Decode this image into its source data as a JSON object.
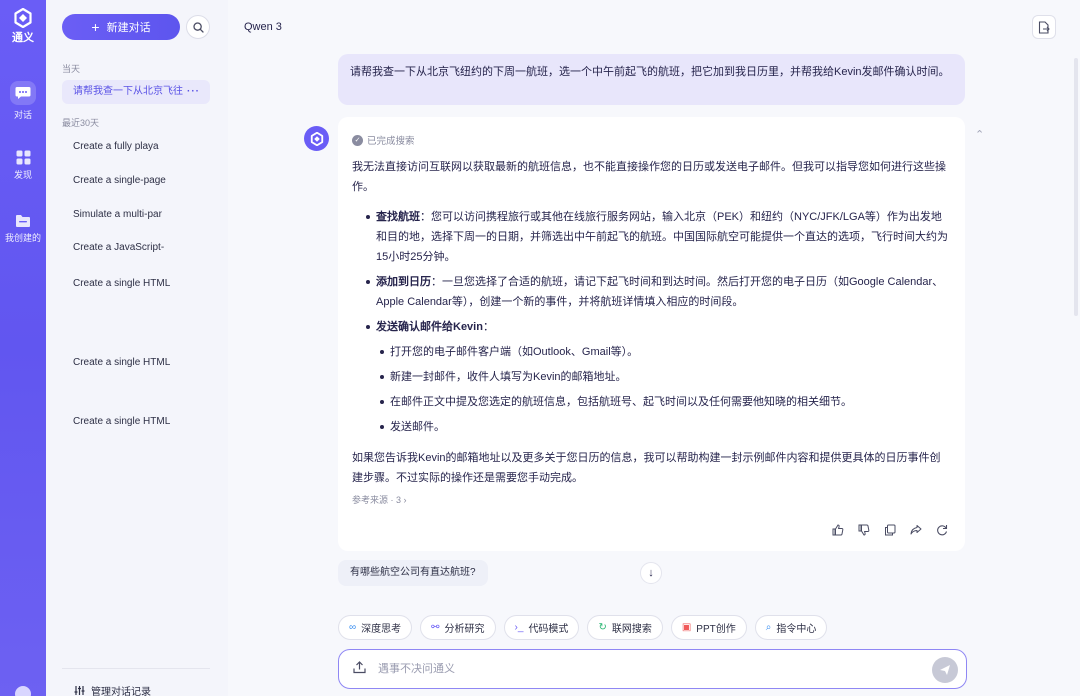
{
  "app": {
    "logo_text": "通义",
    "brand_color": "#6a5df6"
  },
  "rail": {
    "items": [
      {
        "label": "对话",
        "icon": "chat-bubble-icon"
      },
      {
        "label": "发现",
        "icon": "grid-icon"
      },
      {
        "label": "我创建的",
        "icon": "folder-icon"
      }
    ]
  },
  "sidebar": {
    "new_chat_label": "新建对话",
    "today_label": "当天",
    "recent_label": "最近30天",
    "items": [
      {
        "label": "请帮我查一下从北京飞往",
        "more": "···"
      },
      {
        "label": "Create a fully playa"
      },
      {
        "label": "Create a single-page"
      },
      {
        "label": "Simulate a multi-par"
      },
      {
        "label": "Create a JavaScript-"
      },
      {
        "label": "Create a single HTML"
      },
      {
        "label": "Create a single HTML"
      },
      {
        "label": "Create a single HTML"
      }
    ],
    "manage_label": "管理对话记录"
  },
  "main": {
    "model_name": "Qwen 3",
    "user_message": "请帮我查一下从北京飞纽约的下周一航班，选一个中午前起飞的航班，把它加到我日历里，并帮我给Kevin发邮件确认时间。",
    "status": "已完成搜索",
    "intro": "我无法直接访问互联网以获取最新的航班信息，也不能直接操作您的日历或发送电子邮件。但我可以指导您如何进行这些操作。",
    "bullets": [
      {
        "title": "查找航班",
        "text": "：您可以访问携程旅行或其他在线旅行服务网站，输入北京（PEK）和纽约（NYC/JFK/LGA等）作为出发地和目的地，选择下周一的日期，并筛选出中午前起飞的航班。中国国际航空可能提供一个直达的选项，飞行时间大约为15小时25分钟。"
      },
      {
        "title": "添加到日历",
        "text": "：一旦您选择了合适的航班，请记下起飞时间和到达时间。然后打开您的电子日历（如Google Calendar、Apple Calendar等），创建一个新的事件，并将航班详情填入相应的时间段。"
      },
      {
        "title": "发送确认邮件给Kevin",
        "text": "："
      }
    ],
    "sub_bullets": [
      "打开您的电子邮件客户端（如Outlook、Gmail等）。",
      "新建一封邮件，收件人填写为Kevin的邮箱地址。",
      "在邮件正文中提及您选定的航班信息，包括航班号、起飞时间以及任何需要他知晓的相关细节。",
      "发送邮件。"
    ],
    "closing": "如果您告诉我Kevin的邮箱地址以及更多关于您日历的信息，我可以帮助构建一封示例邮件内容和提供更具体的日历事件创建步骤。不过实际的操作还是需要您手动完成。",
    "refs": "参考来源 · 3 ›",
    "suggestion": "有哪些航空公司有直达航班?",
    "chips": [
      {
        "label": "深度思考",
        "icon": "deep-think-icon",
        "glyph": "∞"
      },
      {
        "label": "分析研究",
        "icon": "analysis-icon",
        "glyph": "⚯"
      },
      {
        "label": "代码模式",
        "icon": "code-icon",
        "glyph": "›_"
      },
      {
        "label": "联网搜索",
        "icon": "web-search-icon",
        "glyph": "↻"
      },
      {
        "label": "PPT创作",
        "icon": "ppt-icon",
        "glyph": "▣"
      },
      {
        "label": "指令中心",
        "icon": "command-icon",
        "glyph": "⌕"
      }
    ],
    "input_placeholder": "遇事不决问通义"
  }
}
